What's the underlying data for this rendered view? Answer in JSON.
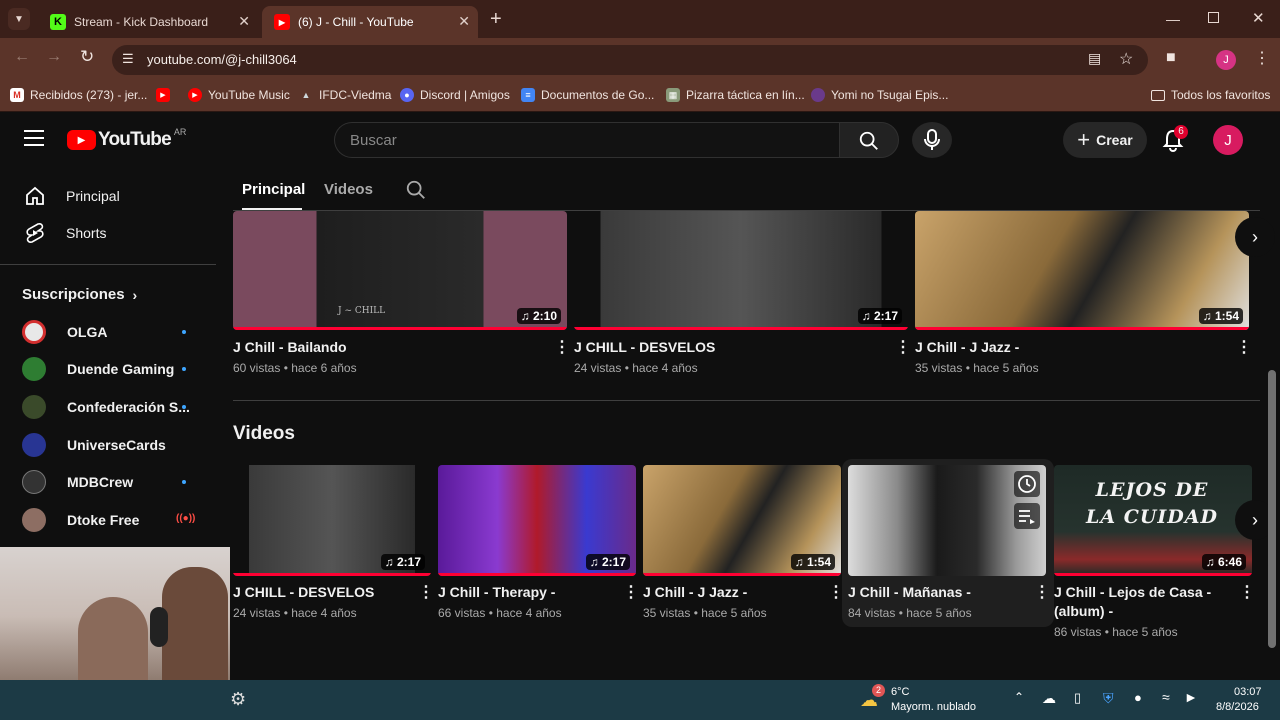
{
  "browser": {
    "tabs": [
      {
        "title": "Stream - Kick Dashboard",
        "favicon": "kick-icon"
      },
      {
        "title": "(6) J - Chill - YouTube",
        "favicon": "youtube-icon"
      }
    ],
    "new_tab": "+",
    "url": "youtube.com/@j-chill3064",
    "profile_initial": "J",
    "bookmarks": [
      {
        "label": "Recibidos (273) - jer...",
        "icon": "gmail-icon"
      },
      {
        "label": "",
        "icon": "youtube-icon"
      },
      {
        "label": "YouTube Music",
        "icon": "youtube-music-icon"
      },
      {
        "label": "IFDC-Viedma",
        "icon": "ifdc-icon"
      },
      {
        "label": "Discord | Amigos",
        "icon": "discord-icon"
      },
      {
        "label": "Documentos de Go...",
        "icon": "docs-icon"
      },
      {
        "label": "Pizarra táctica en lín...",
        "icon": "board-icon"
      },
      {
        "label": "Yomi no Tsugai Epis...",
        "icon": "anime-icon"
      }
    ],
    "all_bookmarks": "Todos los favoritos"
  },
  "youtube": {
    "logo_text": "YouTube",
    "country": "AR",
    "search_placeholder": "Buscar",
    "create_label": "Crear",
    "notifications_count": "6",
    "avatar_initial": "J",
    "sidebar": {
      "items": [
        {
          "label": "Principal",
          "icon": "home-icon"
        },
        {
          "label": "Shorts",
          "icon": "shorts-icon"
        }
      ],
      "subs_heading": "Suscripciones",
      "subscriptions": [
        {
          "name": "OLGA",
          "color": "#e8e8e8",
          "new": true
        },
        {
          "name": "Duende Gaming",
          "color": "#2e7d32",
          "new": true
        },
        {
          "name": "Confederación S...",
          "color": "#3a4a2a",
          "new": true
        },
        {
          "name": "UniverseCards",
          "color": "#283593",
          "new": false
        },
        {
          "name": "MDBCrew",
          "color": "#333333",
          "new": true
        },
        {
          "name": "Dtoke Free",
          "color": "#8d6e63",
          "live": true
        }
      ]
    },
    "channel_tabs": {
      "active": "Principal",
      "other": "Videos"
    },
    "top_row": [
      {
        "title": "J Chill - Bailando",
        "meta": "60 vistas • hace 6 años",
        "duration": "2:10",
        "thumb": "#7a4a5e"
      },
      {
        "title": "J CHILL - DESVELOS",
        "meta": "24 vistas • hace 4 años",
        "duration": "2:17",
        "thumb": "#2a2a2a"
      },
      {
        "title": "J Chill - J Jazz -",
        "meta": "35 vistas • hace 5 años",
        "duration": "1:54",
        "thumb": "#8a6a3a"
      }
    ],
    "videos_heading": "Videos",
    "videos_row": [
      {
        "title": "J CHILL - DESVELOS",
        "meta": "24 vistas • hace 4 años",
        "duration": "2:17",
        "thumb": "#2a2a2a"
      },
      {
        "title": "J Chill - Therapy -",
        "meta": "66 vistas • hace 4 años",
        "duration": "2:17",
        "thumb": "#6a2a8a"
      },
      {
        "title": "J Chill - J Jazz -",
        "meta": "35 vistas • hace 5 años",
        "duration": "1:54",
        "thumb": "#8a6a3a"
      },
      {
        "title": "J Chill - Mañanas -",
        "meta": "84 vistas • hace 5 años",
        "duration": "",
        "thumb": "#4a4a4a"
      },
      {
        "title": "J Chill - Lejos de Casa - (album) -",
        "meta": "86 vistas • hace 5 años",
        "duration": "6:46",
        "thumb": "#1e2a26",
        "overlay_text": "LEJOS DE LA CUIDAD"
      }
    ]
  },
  "taskbar": {
    "weather_temp": "6°C",
    "weather_desc": "Mayorm. nublado",
    "weather_badge": "2",
    "time": "03:07",
    "date": "8/8/2026"
  }
}
